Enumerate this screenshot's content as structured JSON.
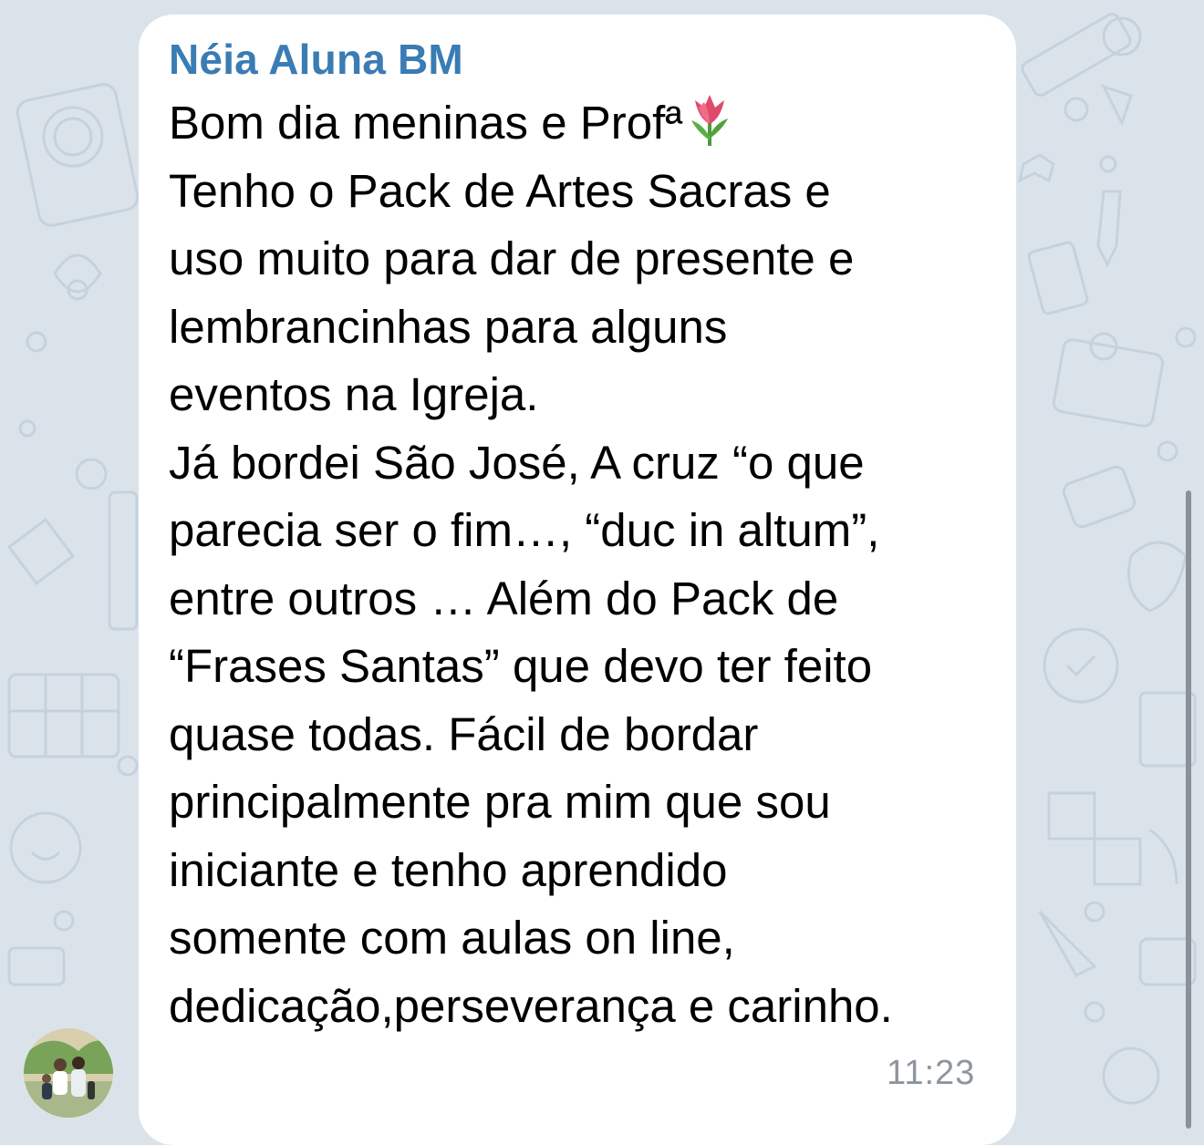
{
  "chat": {
    "sender_name": "Néia Aluna BM",
    "message_lines": [
      "Bom dia meninas e Profª",
      "Tenho o Pack de Artes Sacras e",
      "uso muito para dar de presente e",
      "lembrancinhas para alguns",
      "eventos na Igreja.",
      "Já bordei São José, A cruz “o que",
      "parecia ser o fim…, “duc in altum”,",
      "entre outros … Além do Pack de",
      "“Frases Santas” que devo ter feito",
      "quase todas. Fácil de bordar",
      "principalmente pra mim que sou",
      "iniciante e tenho aprendido",
      "somente com aulas on line,",
      "dedicação,perseverança e carinho."
    ],
    "time": "11:23",
    "emoji": "tulip-icon"
  },
  "colors": {
    "background": "#dbe3ea",
    "bubble": "#ffffff",
    "sender": "#3a7cb4",
    "text": "#000000",
    "time": "#8e959c"
  }
}
